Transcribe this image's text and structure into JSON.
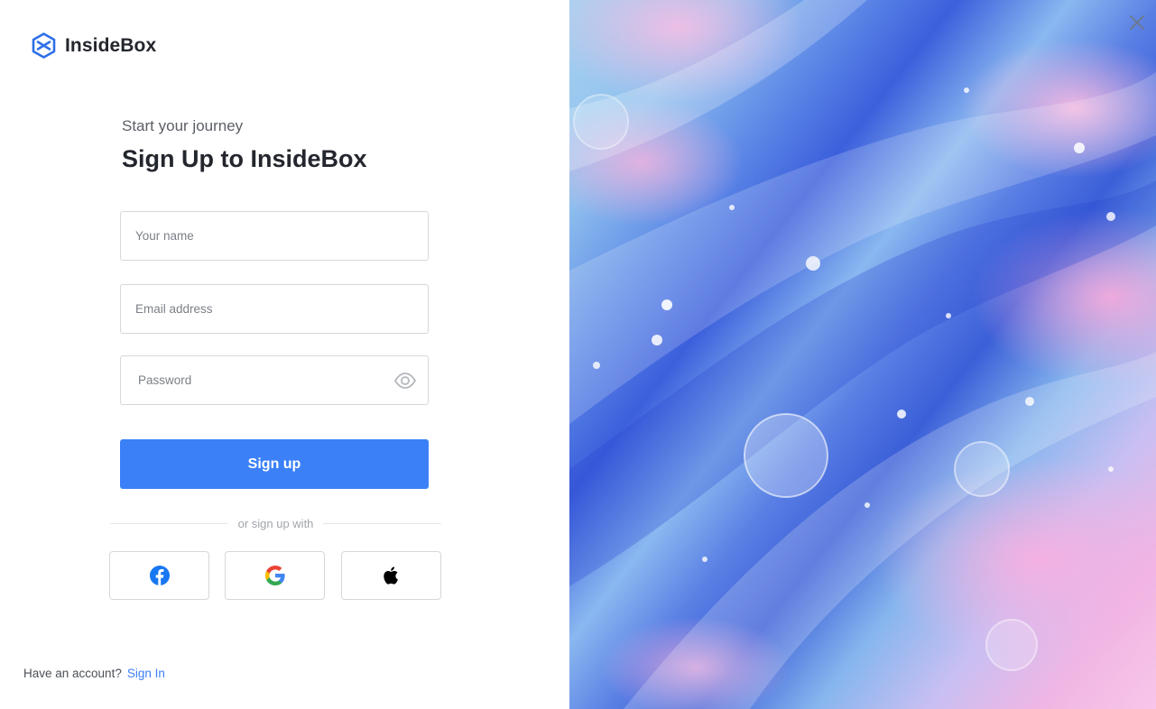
{
  "brand": {
    "name": "InsideBox",
    "logo": "hexagon-x-logo",
    "color": "#2f6fe8"
  },
  "heading": {
    "subtitle": "Start your journey",
    "title": "Sign Up to InsideBox"
  },
  "form": {
    "name_placeholder": "Your name",
    "email_placeholder": "Email address",
    "password_placeholder": "Password",
    "password_toggle_icon": "eye-icon",
    "submit_label": "Sign up",
    "accent_color": "#3b80f7"
  },
  "divider": {
    "text": "or sign up with"
  },
  "social": [
    {
      "provider": "facebook",
      "icon": "facebook-icon"
    },
    {
      "provider": "google",
      "icon": "google-icon"
    },
    {
      "provider": "apple",
      "icon": "apple-icon"
    }
  ],
  "footer": {
    "prompt": "Have an account?",
    "link_label": "Sign In"
  },
  "hero": {
    "close_icon": "close-icon",
    "image": "abstract fluid marble art"
  }
}
